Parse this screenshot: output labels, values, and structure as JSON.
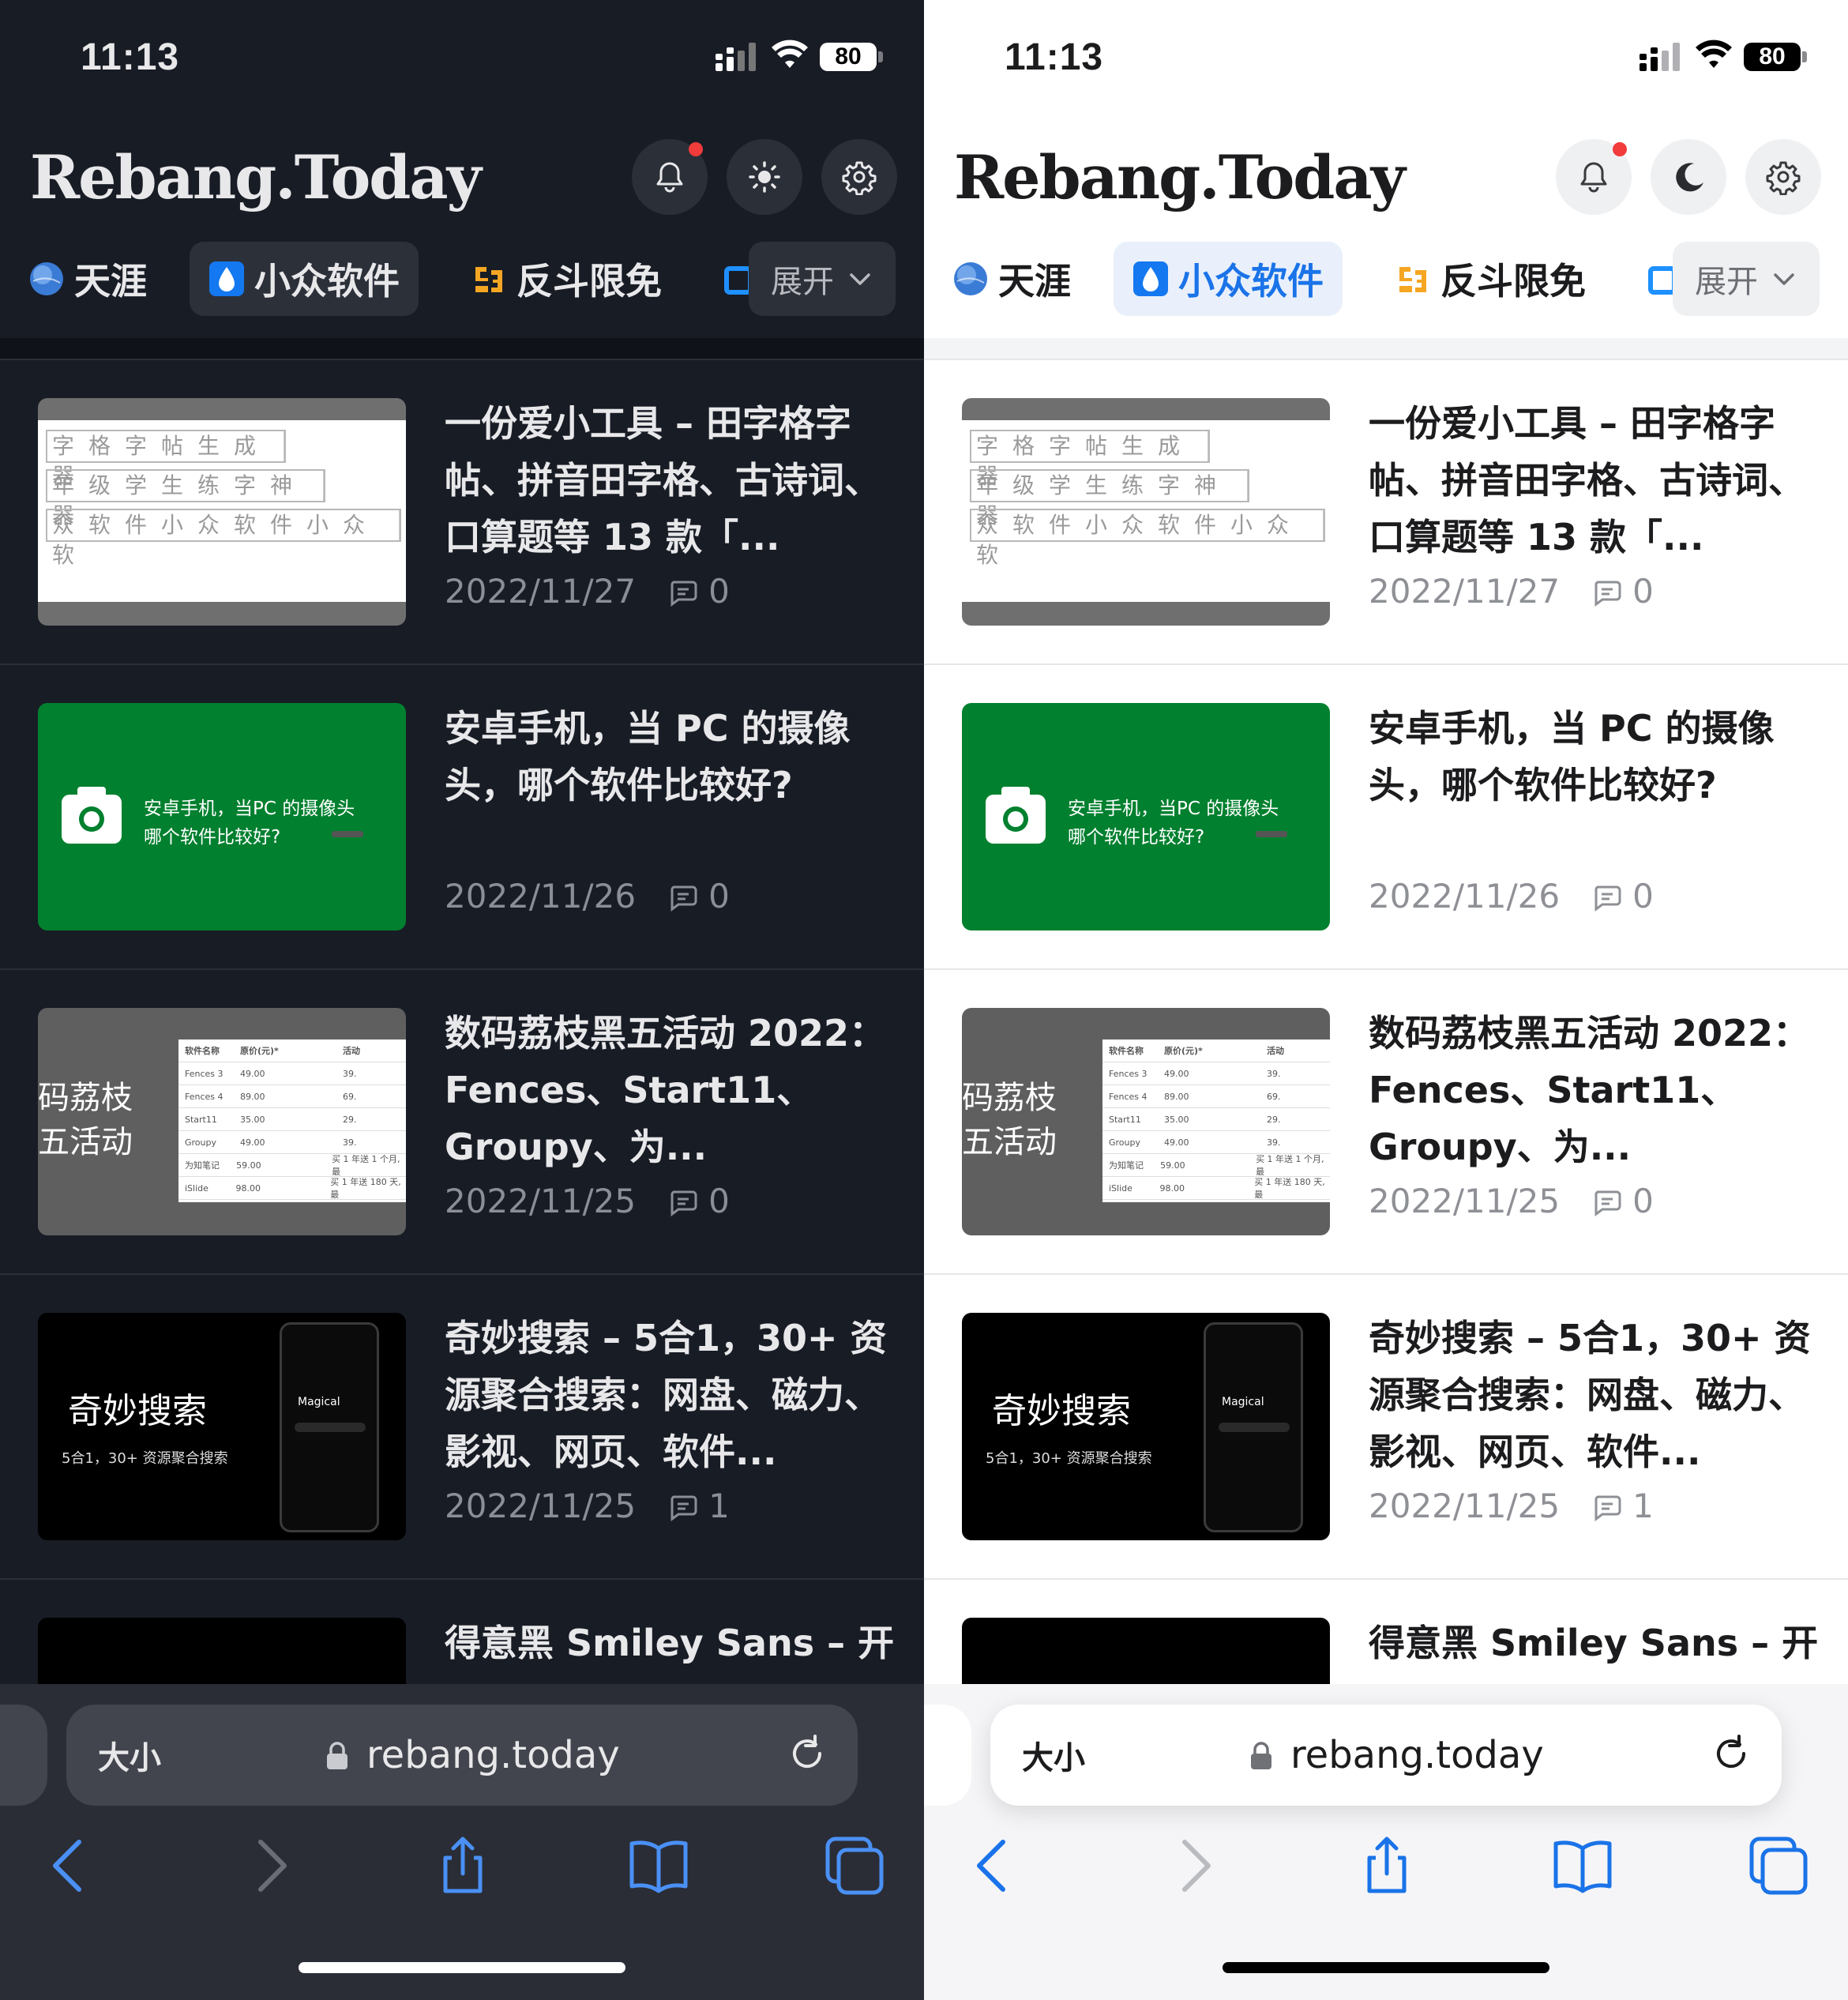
{
  "status": {
    "time": "11:13",
    "battery": "80"
  },
  "header": {
    "logo": "Rebang.Today"
  },
  "tabs": [
    {
      "label": "天涯",
      "icon": "globe-icon"
    },
    {
      "label": "小众软件",
      "icon": "droplet-icon",
      "active": true
    },
    {
      "label": "反斗限免",
      "icon": "gift-icon"
    }
  ],
  "expand_label": "展开",
  "theme_toggle": {
    "left": "sun-icon",
    "right": "moon-icon"
  },
  "items": [
    {
      "title": "一份爱小工具 – 田字格字帖、拼音田字格、古诗词、口算题等 13 款「...",
      "date": "2022/11/27",
      "comments": "0",
      "thumb": {
        "type": "grid",
        "rows": [
          "字格字帖生成器",
          "年级学生练字神器",
          "众软件小众软件小众软"
        ]
      }
    },
    {
      "title": "安卓手机，当 PC 的摄像头，哪个软件比较好?",
      "date": "2022/11/26",
      "comments": "0",
      "thumb": {
        "type": "green",
        "line1": "安卓手机，当PC 的摄像头",
        "line2": "哪个软件比较好?"
      }
    },
    {
      "title": "数码荔枝黑五活动 2022：Fences、Start11、Groupy、为...",
      "date": "2022/11/25",
      "comments": "0",
      "thumb": {
        "type": "table",
        "big1": "码荔枝",
        "big2": "五活动",
        "headers": [
          "软件名称",
          "原价(元)*",
          "活动"
        ],
        "rows": [
          [
            "Fences 3",
            "49.00",
            "39."
          ],
          [
            "Fences 4",
            "89.00",
            "69."
          ],
          [
            "Start11",
            "35.00",
            "29."
          ],
          [
            "Groupy",
            "49.00",
            "39."
          ],
          [
            "为知笔记",
            "59.00",
            "买 1 年送 1 个月, 最"
          ],
          [
            "iSlide",
            "98.00",
            "买 1 年送 180 天, 最"
          ]
        ]
      }
    },
    {
      "title": "奇妙搜索 – 5合1，30+ 资源聚合搜索：网盘、磁力、影视、网页、软件...",
      "date": "2022/11/25",
      "comments": "1",
      "thumb": {
        "type": "black",
        "name": "奇妙搜索",
        "sub": "5合1，30+ 资源聚合搜索",
        "brand": "Magical"
      }
    },
    {
      "title": "得意黑 Smiley Sans – 开",
      "date": "",
      "comments": "",
      "thumb": {
        "type": "dark"
      }
    }
  ],
  "browser": {
    "aa": "大小",
    "url": "rebang.today"
  },
  "colors": {
    "dark_bg": "#181c25",
    "light_bg": "#ffffff",
    "accent": "#1a73e8",
    "notify_dot": "#f23b3b",
    "green_thumb": "#01802f"
  }
}
